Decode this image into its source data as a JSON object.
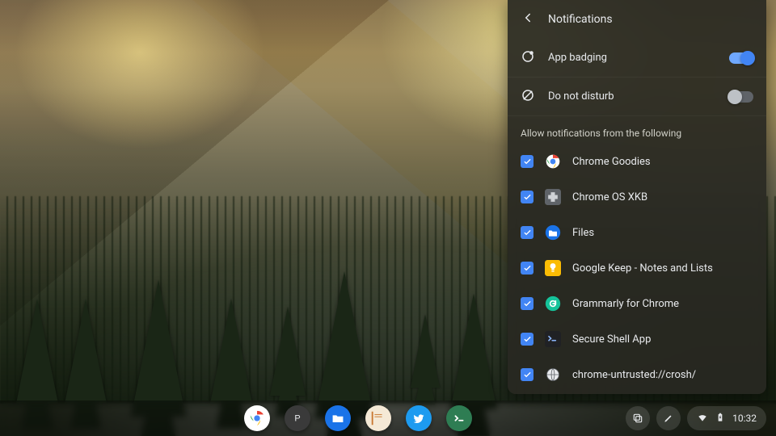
{
  "panel": {
    "title": "Notifications",
    "app_badging": {
      "label": "App badging",
      "on": true
    },
    "dnd": {
      "label": "Do not disturb",
      "on": false
    },
    "allow_label": "Allow notifications from the following",
    "apps": [
      {
        "name": "Chrome Goodies",
        "icon": "chrome",
        "checked": true
      },
      {
        "name": "Chrome OS XKB",
        "icon": "puzzle",
        "checked": true
      },
      {
        "name": "Files",
        "icon": "folder",
        "checked": true
      },
      {
        "name": "Google Keep - Notes and Lists",
        "icon": "keep",
        "checked": true
      },
      {
        "name": "Grammarly for Chrome",
        "icon": "grammarly",
        "checked": true
      },
      {
        "name": "Secure Shell App",
        "icon": "terminal-dark",
        "checked": true
      },
      {
        "name": "chrome-untrusted://crosh/",
        "icon": "globe",
        "checked": true
      }
    ]
  },
  "shelf": {
    "apps": [
      {
        "name": "chrome",
        "color": "#fff"
      },
      {
        "name": "p-app",
        "color": "#3a3a3a"
      },
      {
        "name": "files",
        "color": "#1a73e8"
      },
      {
        "name": "notes",
        "color": "#f5e9d6"
      },
      {
        "name": "twitter",
        "color": "#1d9bf0"
      },
      {
        "name": "terminal",
        "color": "#2e7d53"
      }
    ],
    "tray_icons": [
      "layers",
      "pen"
    ],
    "status": {
      "time": "10:32"
    }
  }
}
